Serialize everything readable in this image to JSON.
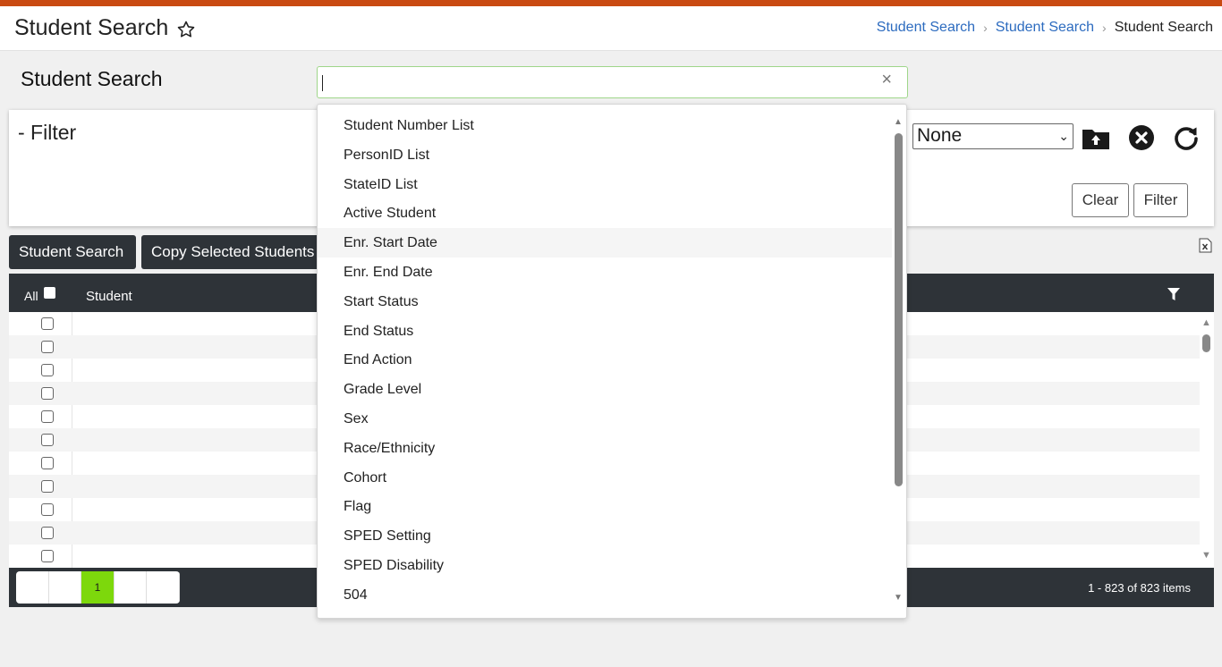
{
  "header": {
    "title": "Student Search",
    "breadcrumb": [
      "Student Search",
      "Student Search",
      "Student Search"
    ]
  },
  "section_title": "Student Search",
  "search": {
    "value": "",
    "placeholder": ""
  },
  "filter_panel": {
    "title": "- Filter",
    "selected_option": "None",
    "clear_label": "Clear",
    "filter_label": "Filter"
  },
  "toolbar": {
    "student_search_label": "Student Search",
    "copy_selected_label": "Copy Selected Students"
  },
  "grid": {
    "all_label": "All",
    "columns": [
      "Student"
    ],
    "rows": [
      {
        "alt": false
      },
      {
        "alt": true
      },
      {
        "alt": false
      },
      {
        "alt": true
      },
      {
        "alt": false
      },
      {
        "alt": true
      },
      {
        "alt": false
      },
      {
        "alt": true
      },
      {
        "alt": false
      },
      {
        "alt": true
      },
      {
        "alt": false
      }
    ]
  },
  "pager": {
    "pages": [
      "",
      "",
      "1",
      "",
      ""
    ],
    "current_page": "1",
    "item_count": "1 - 823 of 823 items"
  },
  "dropdown": {
    "items": [
      "Student Number List",
      "PersonID List",
      "StateID List",
      "Active Student",
      "Enr. Start Date",
      "Enr. End Date",
      "Start Status",
      "End Status",
      "End Action",
      "Grade Level",
      "Sex",
      "Race/Ethnicity",
      "Cohort",
      "Flag",
      "SPED Setting",
      "SPED Disability",
      "504"
    ],
    "highlighted": "Enr. Start Date"
  },
  "colors": {
    "top_strip": "#c94a12",
    "link": "#2c6bbf",
    "dark_bar": "#2e3338",
    "active_page": "#7dd80c",
    "search_border": "#9fd68a"
  },
  "icons": [
    "star-icon",
    "folder-upload-icon",
    "close-circle-icon",
    "refresh-icon",
    "excel-icon",
    "filter-funnel-icon",
    "clear-icon"
  ]
}
